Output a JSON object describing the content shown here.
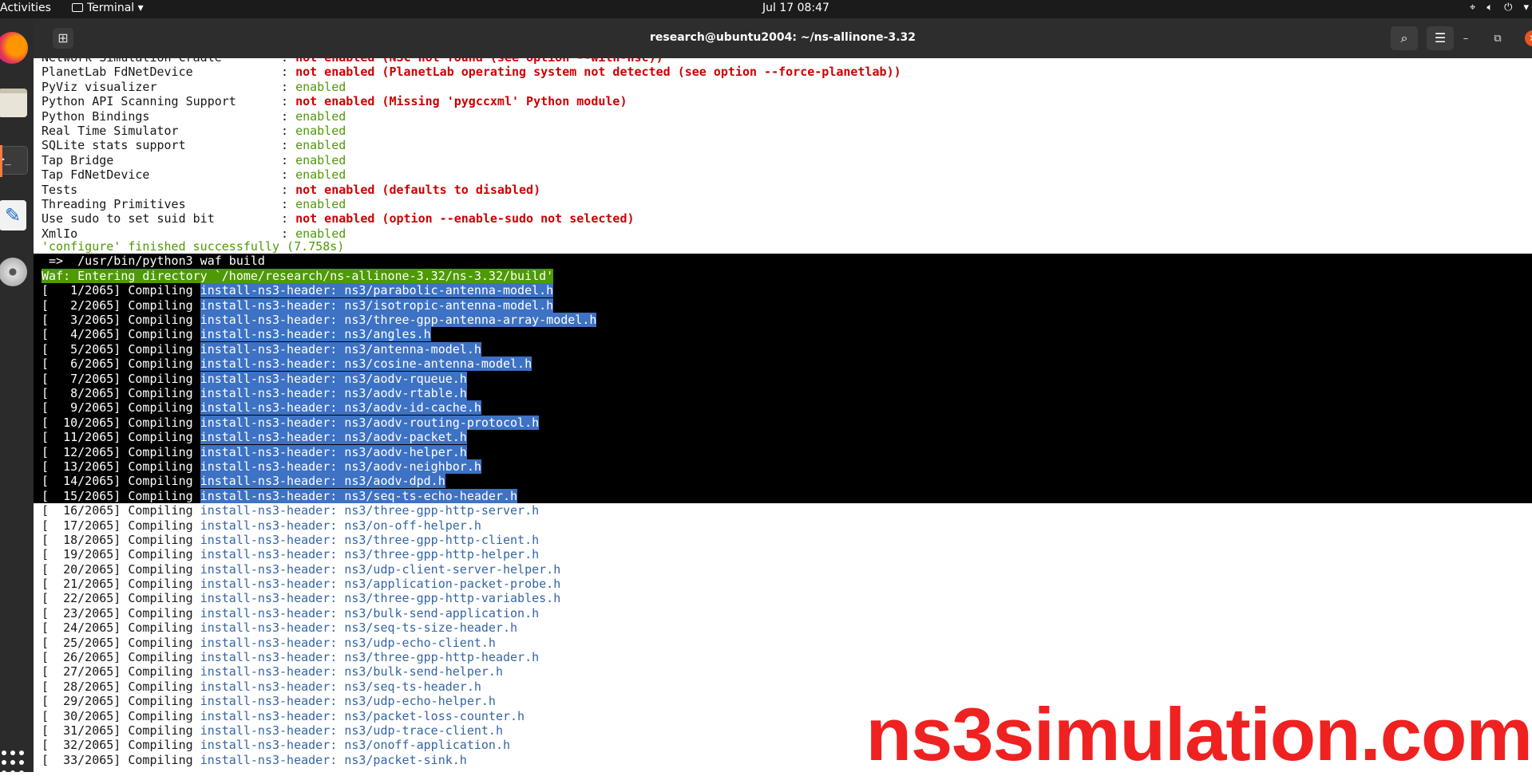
{
  "topbar": {
    "activities": "Activities",
    "app_menu": "Terminal ▾",
    "clock": "Jul 17  08:47",
    "indicators": [
      "network-icon",
      "volume-icon",
      "power-icon"
    ]
  },
  "window": {
    "title": "research@ubuntu2004: ~/ns-allinone-3.32",
    "new_tab_icon": "⊞",
    "search_icon": "⌕",
    "menu_icon": "☰",
    "minimize": "–",
    "maximize": "⧉",
    "close": "✕"
  },
  "config_lines": [
    {
      "label": "Network Simulation Cradle",
      "value": "not enabled (NSC not found (see option --with-nsc))",
      "status": "bad"
    },
    {
      "label": "PlanetLab FdNetDevice",
      "value": "not enabled (PlanetLab operating system not detected (see option --force-planetlab))",
      "status": "bad"
    },
    {
      "label": "PyViz visualizer",
      "value": "enabled",
      "status": "ok"
    },
    {
      "label": "Python API Scanning Support",
      "value": "not enabled (Missing 'pygccxml' Python module)",
      "status": "bad"
    },
    {
      "label": "Python Bindings",
      "value": "enabled",
      "status": "ok"
    },
    {
      "label": "Real Time Simulator",
      "value": "enabled",
      "status": "ok"
    },
    {
      "label": "SQLite stats support",
      "value": "enabled",
      "status": "ok"
    },
    {
      "label": "Tap Bridge",
      "value": "enabled",
      "status": "ok"
    },
    {
      "label": "Tap FdNetDevice",
      "value": "enabled",
      "status": "ok"
    },
    {
      "label": "Tests",
      "value": "not enabled (defaults to disabled)",
      "status": "bad"
    },
    {
      "label": "Threading Primitives",
      "value": "enabled",
      "status": "ok"
    },
    {
      "label": "Use sudo to set suid bit",
      "value": "not enabled (option --enable-sudo not selected)",
      "status": "bad"
    },
    {
      "label": "XmlIo",
      "value": "enabled",
      "status": "ok"
    }
  ],
  "separator": ": ",
  "finished_line": "'configure' finished successfully (7.758s)",
  "command_line": " =>  /usr/bin/python3 waf build",
  "waf_line": "Waf: Entering directory `/home/research/ns-allinone-3.32/ns-3.32/build'",
  "compile_verb": "Compiling",
  "task_prefix": "install-ns3-header:",
  "compile_lines": [
    {
      "counter": "[   1/2065]",
      "file": "ns3/parabolic-antenna-model.h"
    },
    {
      "counter": "[   2/2065]",
      "file": "ns3/isotropic-antenna-model.h"
    },
    {
      "counter": "[   3/2065]",
      "file": "ns3/three-gpp-antenna-array-model.h"
    },
    {
      "counter": "[   4/2065]",
      "file": "ns3/angles.h"
    },
    {
      "counter": "[   5/2065]",
      "file": "ns3/antenna-model.h"
    },
    {
      "counter": "[   6/2065]",
      "file": "ns3/cosine-antenna-model.h"
    },
    {
      "counter": "[   7/2065]",
      "file": "ns3/aodv-rqueue.h"
    },
    {
      "counter": "[   8/2065]",
      "file": "ns3/aodv-rtable.h"
    },
    {
      "counter": "[   9/2065]",
      "file": "ns3/aodv-id-cache.h"
    },
    {
      "counter": "[  10/2065]",
      "file": "ns3/aodv-routing-protocol.h"
    },
    {
      "counter": "[  11/2065]",
      "file": "ns3/aodv-packet.h"
    },
    {
      "counter": "[  12/2065]",
      "file": "ns3/aodv-helper.h"
    },
    {
      "counter": "[  13/2065]",
      "file": "ns3/aodv-neighbor.h"
    },
    {
      "counter": "[  14/2065]",
      "file": "ns3/aodv-dpd.h"
    },
    {
      "counter": "[  15/2065]",
      "file": "ns3/seq-ts-echo-header.h"
    },
    {
      "counter": "[  16/2065]",
      "file": "ns3/three-gpp-http-server.h"
    },
    {
      "counter": "[  17/2065]",
      "file": "ns3/on-off-helper.h"
    },
    {
      "counter": "[  18/2065]",
      "file": "ns3/three-gpp-http-client.h"
    },
    {
      "counter": "[  19/2065]",
      "file": "ns3/three-gpp-http-helper.h"
    },
    {
      "counter": "[  20/2065]",
      "file": "ns3/udp-client-server-helper.h"
    },
    {
      "counter": "[  21/2065]",
      "file": "ns3/application-packet-probe.h"
    },
    {
      "counter": "[  22/2065]",
      "file": "ns3/three-gpp-http-variables.h"
    },
    {
      "counter": "[  23/2065]",
      "file": "ns3/bulk-send-application.h"
    },
    {
      "counter": "[  24/2065]",
      "file": "ns3/seq-ts-size-header.h"
    },
    {
      "counter": "[  25/2065]",
      "file": "ns3/udp-echo-client.h"
    },
    {
      "counter": "[  26/2065]",
      "file": "ns3/three-gpp-http-header.h"
    },
    {
      "counter": "[  27/2065]",
      "file": "ns3/bulk-send-helper.h"
    },
    {
      "counter": "[  28/2065]",
      "file": "ns3/seq-ts-header.h"
    },
    {
      "counter": "[  29/2065]",
      "file": "ns3/udp-echo-helper.h"
    },
    {
      "counter": "[  30/2065]",
      "file": "ns3/packet-loss-counter.h"
    },
    {
      "counter": "[  31/2065]",
      "file": "ns3/udp-trace-client.h"
    },
    {
      "counter": "[  32/2065]",
      "file": "ns3/onoff-application.h"
    },
    {
      "counter": "[  33/2065]",
      "file": "ns3/packet-sink.h"
    }
  ],
  "selected_through_line": 15,
  "watermark": "ns3simulation.com"
}
